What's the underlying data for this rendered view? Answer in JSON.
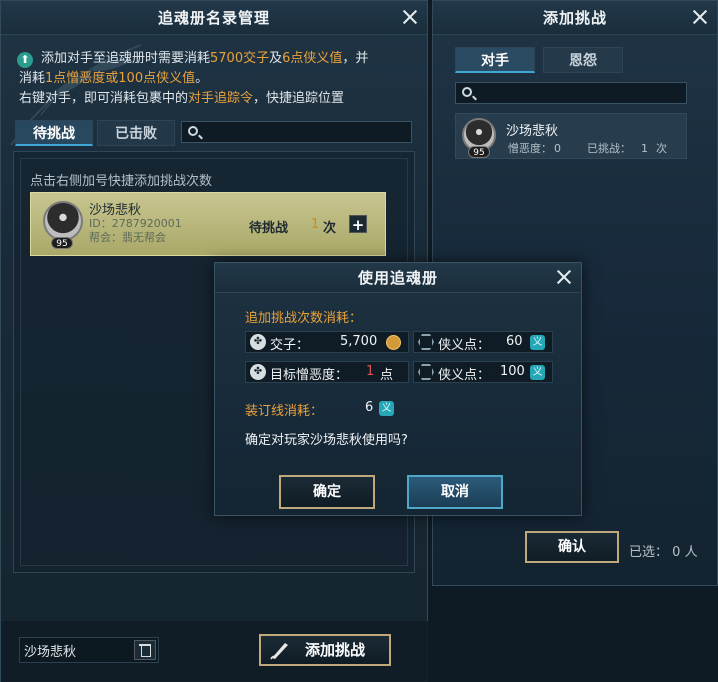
{
  "left_panel": {
    "title": "追魂册名录管理",
    "info": {
      "line1_a": "添加对手至追魂册时需要消耗",
      "line1_b": "5700交子",
      "line1_c": "及",
      "line1_d": "6点侠义值",
      "line1_e": "，并",
      "line2_a": "消耗",
      "line2_b": "1点憎恶度或100点侠义值",
      "line2_c": "。",
      "line3_a": "右键对手，即可消耗包裹中的",
      "line3_b": "对手追踪令",
      "line3_c": "，快捷追踪位置"
    },
    "tabs": [
      "待挑战",
      "已击败"
    ],
    "hint": "点击右侧加号快捷添加挑战次数",
    "opponent": {
      "name": "沙场悲秋",
      "id_line": "ID：2787920001",
      "guild_line": "帮会：翡无帮会",
      "level": "95",
      "status": "待挑战",
      "count": "1",
      "count_unit": "次",
      "plus": "+"
    },
    "name_field_value": "沙场悲秋",
    "add_button": "添加挑战"
  },
  "right_panel": {
    "title": "添加挑战",
    "tabs": [
      "对手",
      "恩怨"
    ],
    "card": {
      "name": "沙场悲秋",
      "level": "95",
      "hate_label": "憎恶度：",
      "hate_val": "0",
      "challenged_label": "已挑战：",
      "challenged_val": "1",
      "challenged_unit": "次"
    },
    "confirm_button": "确认",
    "selected_label": "已选：",
    "selected_val": "0",
    "selected_unit": "人"
  },
  "dialog": {
    "title": "使用追魂册",
    "cost_label": "追加挑战次数消耗：",
    "row1_left_label": "交子：",
    "row1_left_val": "5,700",
    "row1_right_label": "侠义点：",
    "row1_right_val": "60",
    "row2_left_label": "目标憎恶度：",
    "row2_left_val": "1",
    "row2_left_unit": "点",
    "row2_right_label": "侠义点：",
    "row2_right_val": "100",
    "binding_label": "装订线消耗：",
    "binding_val": "6",
    "question": "确定对玩家沙场悲秋使用吗?",
    "ok_button": "确定",
    "cancel_button": "取消",
    "yi_glyph": "义"
  }
}
